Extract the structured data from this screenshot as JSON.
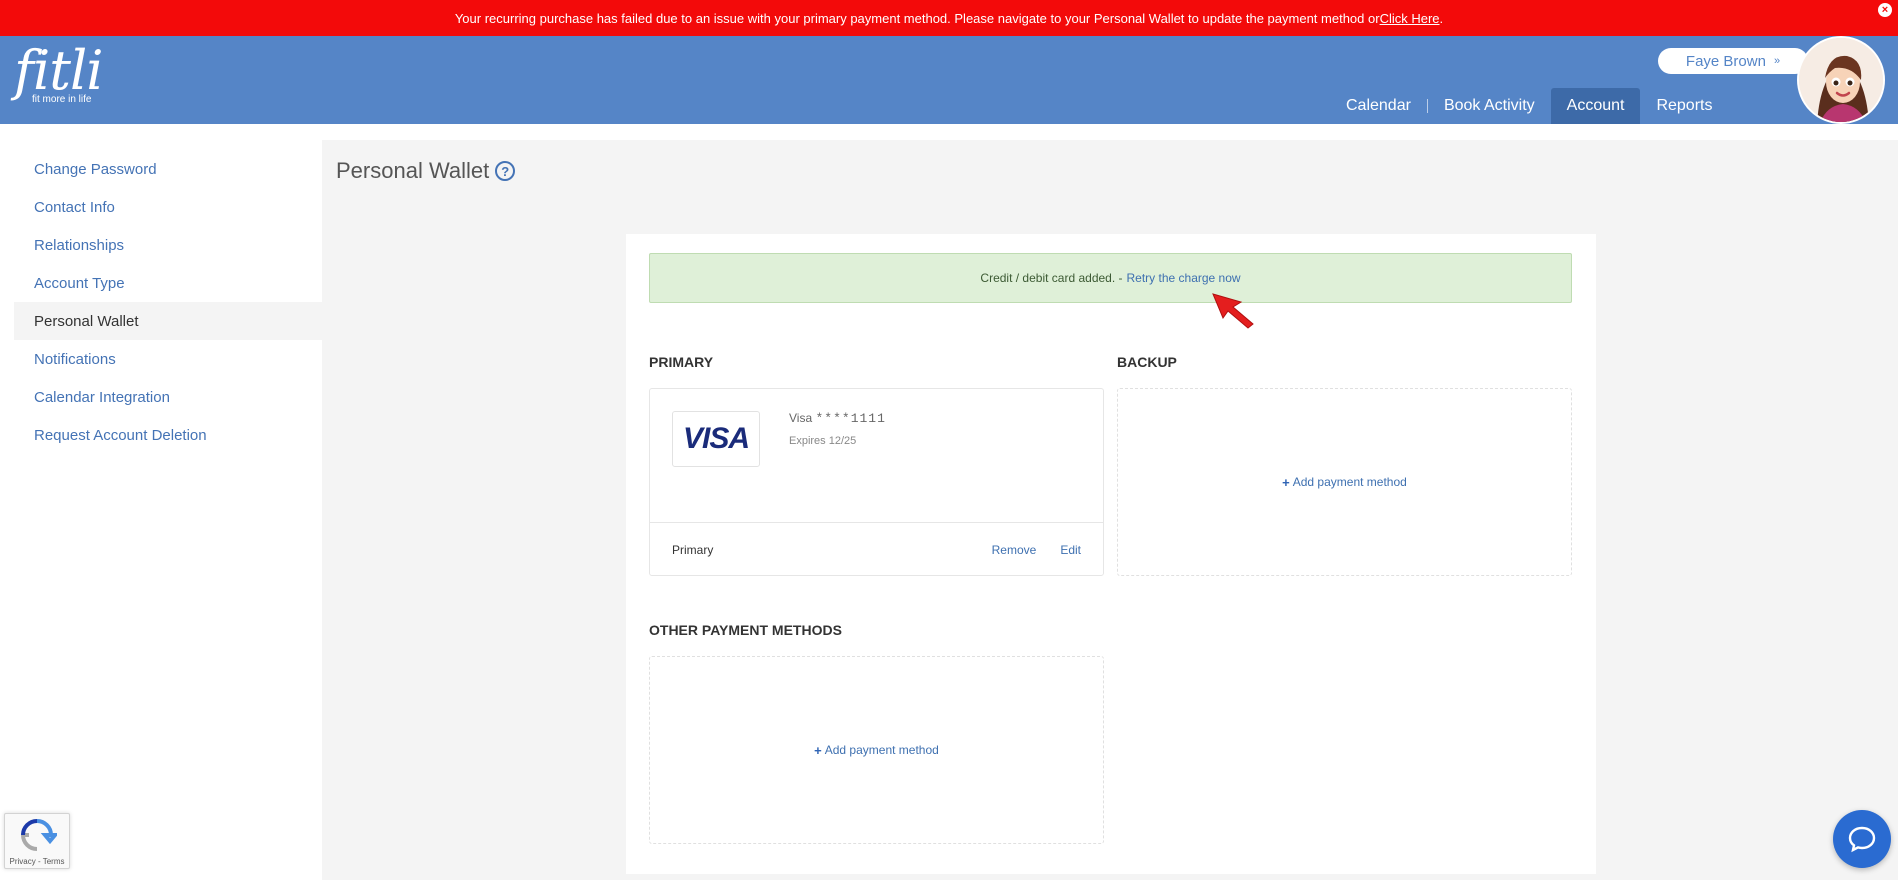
{
  "alert": {
    "message": "Your recurring purchase has failed due to an issue with your primary payment method. Please navigate to your Personal Wallet to update the payment method or ",
    "link": "Click Here",
    "suffix": ".",
    "close_symbol": "×"
  },
  "header": {
    "logo_word": "fitli",
    "logo_tagline": "fit more in life",
    "user_name": "Faye Brown",
    "user_chevron": "»",
    "nav": [
      {
        "label": "Calendar"
      },
      {
        "label": "Book Activity"
      },
      {
        "label": "Account"
      },
      {
        "label": "Reports"
      }
    ],
    "active_nav": "Account"
  },
  "sidebar": {
    "items": [
      {
        "label": "Change Password"
      },
      {
        "label": "Contact Info"
      },
      {
        "label": "Relationships"
      },
      {
        "label": "Account Type"
      },
      {
        "label": "Personal Wallet"
      },
      {
        "label": "Notifications"
      },
      {
        "label": "Calendar Integration"
      },
      {
        "label": "Request Account Deletion"
      }
    ],
    "active_item": "Personal Wallet"
  },
  "main": {
    "title": "Personal Wallet",
    "help_symbol": "?",
    "success": {
      "text": "Credit / debit card added. -",
      "link": "Retry the charge now"
    },
    "primary": {
      "section_title": "PRIMARY",
      "logo_text": "VISA",
      "brand": "Visa",
      "masked_number": "****1111",
      "expires": "Expires 12/25",
      "footer_label": "Primary",
      "remove_label": "Remove",
      "edit_label": "Edit"
    },
    "backup": {
      "section_title": "BACKUP",
      "add_label": "Add payment method"
    },
    "other": {
      "section_title": "OTHER PAYMENT METHODS",
      "add_label": "Add payment method"
    }
  },
  "recaptcha": {
    "label": "Privacy - Terms"
  },
  "colors": {
    "alert_bg": "#f30a0a",
    "header_bg": "#5585c7",
    "nav_active_bg": "#3d6aa8",
    "link": "#4473b5",
    "success_bg": "#dff0d8",
    "chat_bg": "#2a6bd1"
  },
  "icons": {
    "alert_close": "close-circle-icon",
    "help": "question-circle-icon",
    "add": "plus-icon",
    "chat": "chat-bubble-icon",
    "recaptcha": "recaptcha-icon"
  }
}
